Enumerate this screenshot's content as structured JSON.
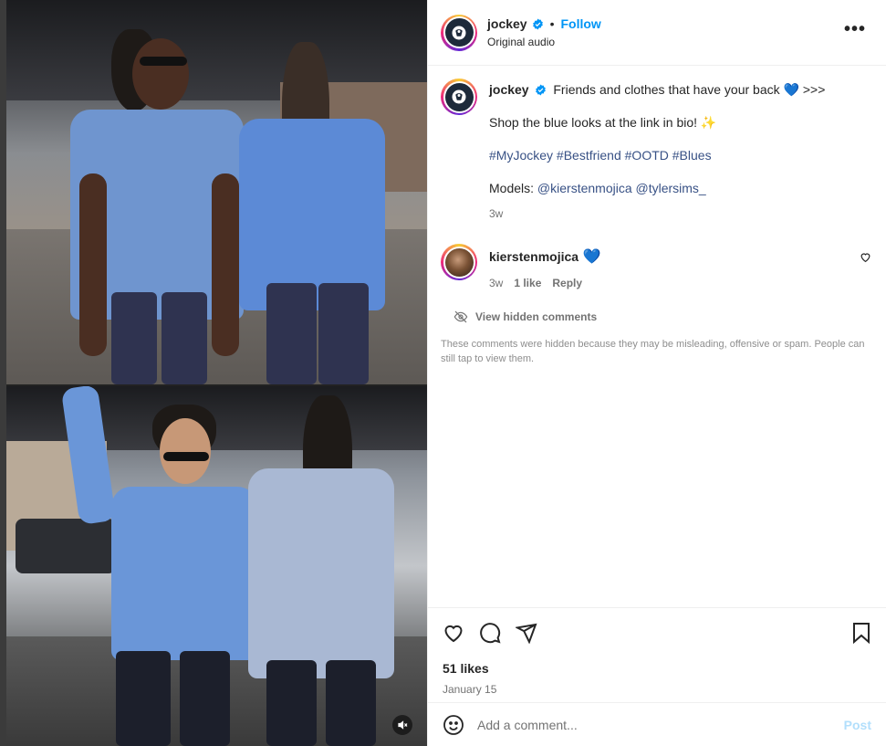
{
  "post": {
    "author": "jockey",
    "follow_label": "Follow",
    "audio": "Original audio",
    "separator": "•",
    "more_label": "•••"
  },
  "caption": {
    "username": "jockey",
    "line1": "Friends and clothes that have your back 💙 >>>",
    "line2": "Shop the blue looks at the link in bio! ✨",
    "hashtags": [
      "#MyJockey",
      "#Bestfriend",
      "#OOTD",
      "#Blues"
    ],
    "models_prefix": "Models:",
    "mentions": [
      "@kierstenmojica",
      "@tylersims_"
    ],
    "time": "3w"
  },
  "comment": {
    "username": "kierstenmojica",
    "text": "💙",
    "time": "3w",
    "likes": "1 like",
    "reply_label": "Reply"
  },
  "hidden": {
    "link_label": "View hidden comments",
    "note": "These comments were hidden because they may be misleading, offensive or spam. People can still tap to view them."
  },
  "stats": {
    "likes": "51 likes",
    "date": "January 15"
  },
  "composer": {
    "placeholder": "Add a comment...",
    "post_label": "Post"
  },
  "icons": {
    "verified": "verified-badge-icon",
    "like": "heart-icon",
    "comment": "comment-icon",
    "share": "share-icon",
    "save": "bookmark-icon",
    "emoji": "emoji-icon",
    "mute": "speaker-muted-icon",
    "hidden": "eye-slash-icon"
  },
  "colors": {
    "link": "#0095f6",
    "hashtag": "#385185",
    "muted": "#737373",
    "post_disabled": "#b2dffc"
  }
}
